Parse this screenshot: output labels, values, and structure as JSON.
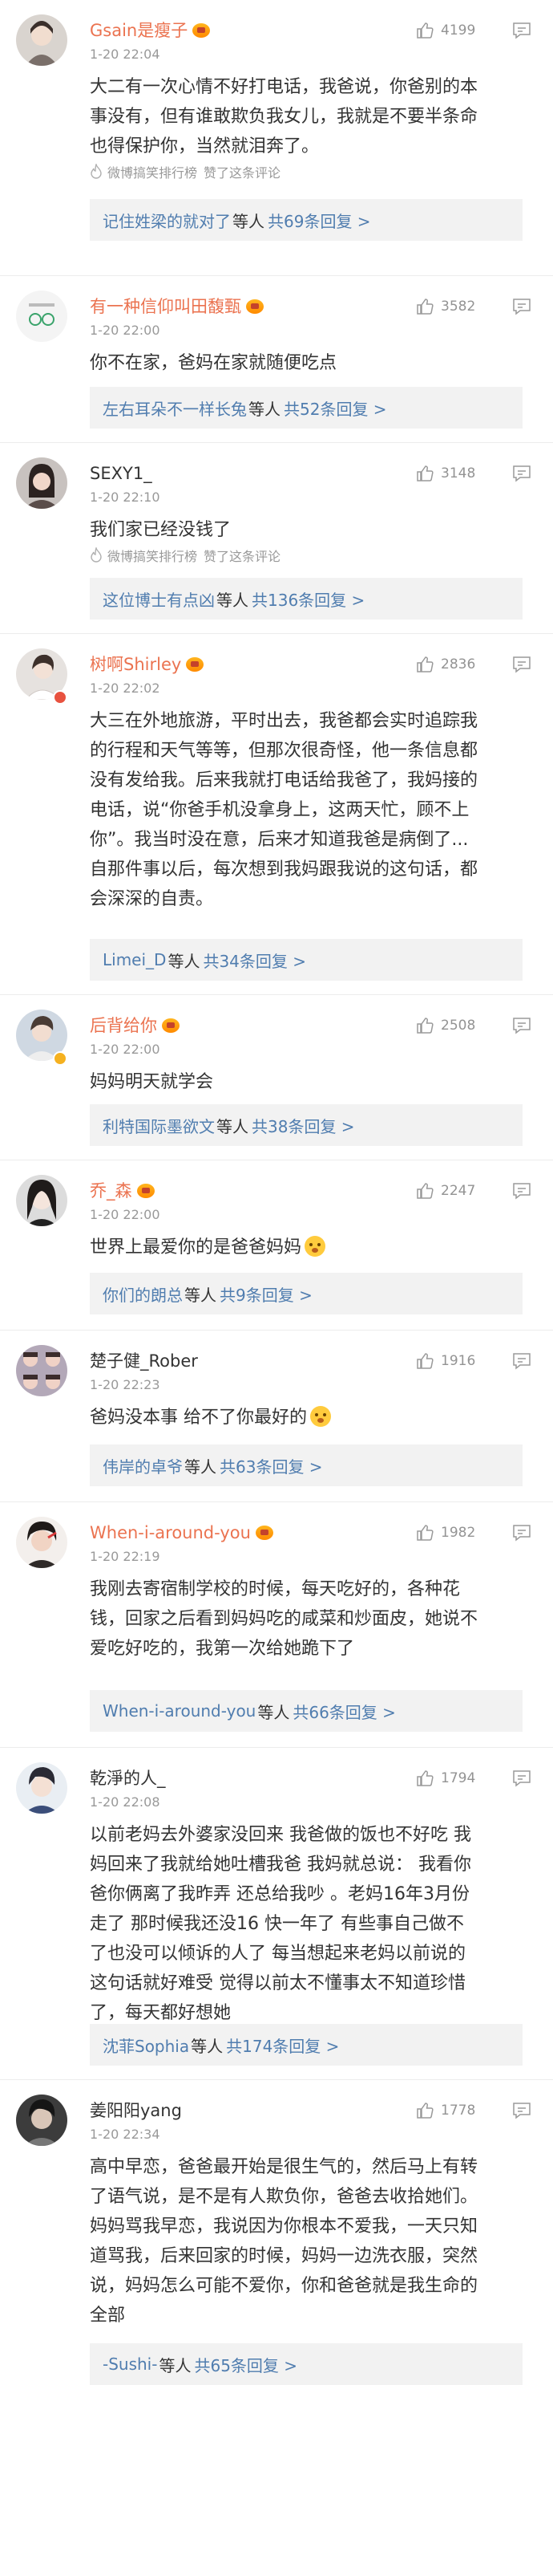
{
  "labels": {
    "etc": "等人",
    "hot_rank": "微博搞笑排行榜",
    "liked_comment": "赞了这条评论"
  },
  "comments": [
    {
      "username": "Gsain是瘦子",
      "time": "1-20 22:04",
      "likes": "4199",
      "body_lines": [
        "大二有一次心情不好打电话，我爸说，你爸别的本",
        "事没有，但有谁敢欺负我女儿，我就是不要半条命",
        "也得保护你，当然就泪奔了。"
      ],
      "reply_names": "记住姓梁的就对了",
      "reply_total": "共69条回复 >"
    },
    {
      "username": "有一种信仰叫田馥甄",
      "time": "1-20 22:00",
      "likes": "3582",
      "body_lines": [
        "你不在家，爸妈在家就随便吃点"
      ],
      "reply_names": "左右耳朵不一样长兔",
      "reply_total": "共52条回复 >"
    },
    {
      "username": "SEXY1_",
      "time": "1-20 22:10",
      "likes": "3148",
      "body_lines": [
        "我们家已经没钱了"
      ],
      "reply_names": "这位博士有点凶",
      "reply_total": "共136条回复 >"
    },
    {
      "username": "树啊Shirley",
      "time": "1-20 22:02",
      "likes": "2836",
      "body_lines": [
        "大三在外地旅游，平时出去，我爸都会实时追踪我",
        "的行程和天气等等，但那次很奇怪，他一条信息都",
        "没有发给我。后来我就打电话给我爸了，我妈接的",
        "电话，说“你爸手机没拿身上，这两天忙，顾不上",
        "你”。我当时没在意，后来才知道我爸是病倒了...",
        "自那件事以后，每次想到我妈跟我说的这句话，都",
        "会深深的自责。"
      ],
      "reply_names": "Limei_D",
      "reply_total": "共34条回复 >"
    },
    {
      "username": "后背给你",
      "time": "1-20 22:00",
      "likes": "2508",
      "body_lines": [
        "妈妈明天就学会"
      ],
      "reply_names": "利特国际墨欲文",
      "reply_total": "共38条回复 >"
    },
    {
      "username": "乔_森",
      "time": "1-20 22:00",
      "likes": "2247",
      "body_lines": [
        "世界上最爱你的是爸爸妈妈"
      ],
      "reply_names": "你们的朗总",
      "reply_total": "共9条回复 >"
    },
    {
      "username": "楚子健_Rober",
      "time": "1-20 22:23",
      "likes": "1916",
      "body_lines": [
        "爸妈没本事 给不了你最好的"
      ],
      "reply_names": "伟岸的卓爷",
      "reply_total": "共63条回复 >"
    },
    {
      "username": "When-i-around-you",
      "time": "1-20 22:19",
      "likes": "1982",
      "body_lines": [
        "我刚去寄宿制学校的时候，每天吃好的，各种花",
        "钱，回家之后看到妈妈吃的咸菜和炒面皮，她说不",
        "爱吃好吃的，我第一次给她跪下了"
      ],
      "reply_names": "When-i-around-you",
      "reply_total": "共66条回复 >"
    },
    {
      "username": "乾淨的人_",
      "time": "1-20 22:08",
      "likes": "1794",
      "body_lines": [
        "以前老妈去外婆家没回来 我爸做的饭也不好吃 我",
        "妈回来了我就给她吐槽我爸 我妈就总说：  我看你",
        "爸你俩离了我昨弄 还总给我吵 。老妈16年3月份",
        "走了 那时候我还没16 快一年了  有些事自己做不",
        "了也没可以倾诉的人了 每当想起来老妈以前说的",
        "这句话就好难受 觉得以前太不懂事太不知道珍惜",
        "了，每天都好想她"
      ],
      "reply_names": "沈菲Sophia",
      "reply_total": "共174条回复 >"
    },
    {
      "username": "姜阳阳yang",
      "time": "1-20 22:34",
      "likes": "1778",
      "body_lines": [
        "高中早恋，爸爸最开始是很生气的，然后马上有转",
        "了语气说，是不是有人欺负你，爸爸去收拾她们。",
        "妈妈骂我早恋，我说因为你根本不爱我，一天只知",
        "道骂我，后来回家的时候，妈妈一边洗衣服，突然",
        "说，妈妈怎么可能不爱你，你和爸爸就是我生命的",
        "全部"
      ],
      "reply_names": "-Sushi-",
      "reply_total": "共65条回复 >"
    }
  ]
}
